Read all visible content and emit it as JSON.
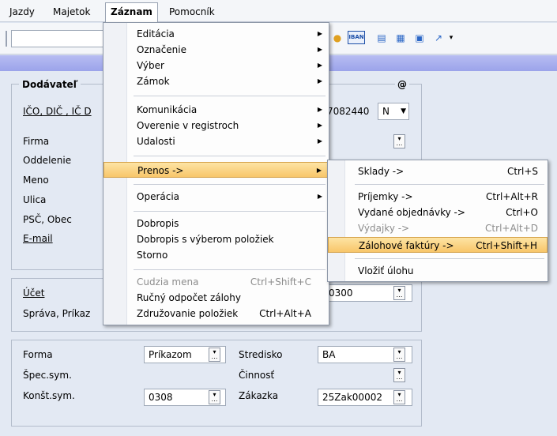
{
  "menubar": {
    "items": [
      "Jazdy",
      "Majetok",
      "Záznam",
      "Pomocník"
    ]
  },
  "toolbar": {
    "iban_label": "IBAN",
    "help_arrow": "▾"
  },
  "form": {
    "dodavatel_title": "Dodávateľ",
    "at_label": "@",
    "ico_label": "IČO, DIČ , IČ D",
    "ico_value_tail": "7082440",
    "n_value": "N",
    "firma": "Firma",
    "oddelenie": "Oddelenie",
    "meno": "Meno",
    "ulica": "Ulica",
    "psc_obec": "PSČ, Obec",
    "email": "E-mail",
    "ucet": "Účet",
    "ucet_value_tail": "0300",
    "sprava_prikaz": "Správa, Príkaz",
    "forma": "Forma",
    "forma_value": "Príkazom",
    "spec_sym": "Špec.sym.",
    "konst_sym": "Konšt.sym.",
    "konst_sym_value": "0308",
    "stredisko": "Stredisko",
    "stredisko_value": "BA",
    "cinnost": "Činnosť",
    "zakazka": "Zákazka",
    "zakazka_value": "25Zak00002"
  },
  "menu_zaznam": {
    "items": [
      {
        "label": "Editácia",
        "submenu": true
      },
      {
        "label": "Označenie",
        "submenu": true
      },
      {
        "label": "Výber",
        "submenu": true
      },
      {
        "label": "Zámok",
        "submenu": true
      },
      {
        "label": "Komunikácia",
        "submenu": true
      },
      {
        "label": "Overenie v registroch",
        "submenu": true
      },
      {
        "label": "Udalosti",
        "submenu": true
      },
      {
        "label": "Prenos ->",
        "submenu": true,
        "highlighted": true
      },
      {
        "label": "Operácia",
        "submenu": true
      },
      {
        "label": "Dobropis"
      },
      {
        "label": "Dobropis s výberom položiek"
      },
      {
        "label": "Storno"
      },
      {
        "label": "Cudzia mena",
        "shortcut": "Ctrl+Shift+C",
        "disabled": true
      },
      {
        "label": "Ručný odpočet zálohy"
      },
      {
        "label": "Združovanie položiek",
        "shortcut": "Ctrl+Alt+A"
      }
    ]
  },
  "menu_prenos": {
    "items": [
      {
        "label": "Sklady ->",
        "shortcut": "Ctrl+S"
      },
      {
        "label": "Príjemky ->",
        "shortcut": "Ctrl+Alt+R"
      },
      {
        "label": "Vydané objednávky ->",
        "shortcut": "Ctrl+O"
      },
      {
        "label": "Výdajky ->",
        "shortcut": "Ctrl+Alt+D",
        "disabled": true
      },
      {
        "label": "Zálohové faktúry ->",
        "shortcut": "Ctrl+Shift+H",
        "highlighted": true
      },
      {
        "label": "Vložiť úlohu"
      }
    ]
  },
  "colors": {
    "highlight": "#f8c66a",
    "accent_bar": "#9ba3ea"
  }
}
